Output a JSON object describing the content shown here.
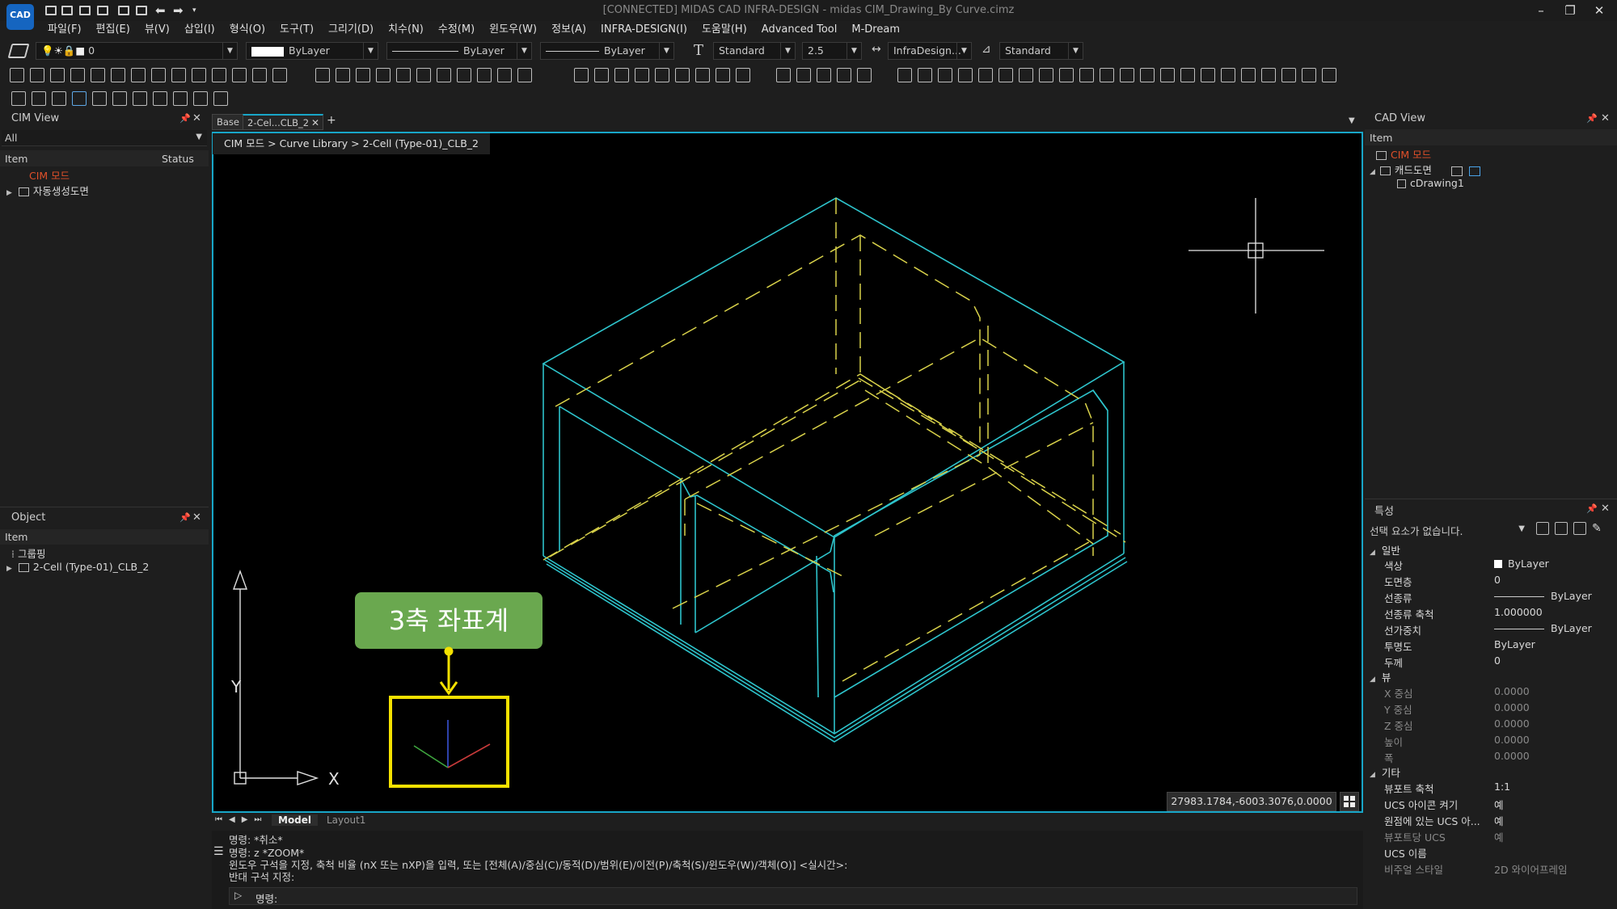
{
  "title": {
    "logo_text": "CAD",
    "window_title": "[CONNECTED] MIDAS CAD INFRA-DESIGN - midas CIM_Drawing_By Curve.cimz",
    "controls": [
      "–",
      "❐",
      "✕"
    ]
  },
  "menu": [
    "파일(F)",
    "편집(E)",
    "뷰(V)",
    "삽입(I)",
    "형식(O)",
    "도구(T)",
    "그리기(D)",
    "치수(N)",
    "수정(M)",
    "윈도우(W)",
    "정보(A)",
    "INFRA-DESIGN(I)",
    "도움말(H)",
    "Advanced Tool",
    "M-Dream"
  ],
  "properties_toolbar": {
    "layer": "0",
    "color": "ByLayer",
    "linetype": "ByLayer",
    "lineweight": "ByLayer",
    "text_style": "Standard",
    "text_height": "2.5",
    "dim_style": "InfraDesign...",
    "table_style": "Standard"
  },
  "cim_view": {
    "title": "CIM View",
    "filter": "All",
    "col_item": "Item",
    "col_status": "Status",
    "items": [
      "CIM 모드",
      "자동생성도면"
    ]
  },
  "object_panel": {
    "title": "Object",
    "col_item": "Item",
    "items": [
      "그룹핑",
      "2-Cell (Type-01)_CLB_2"
    ]
  },
  "tabs": [
    "Base",
    "2-Cel...CLB_2",
    "+"
  ],
  "breadcrumb": "CIM 모드 > Curve Library > 2-Cell (Type-01)_CLB_2",
  "viewport": {
    "axis_x": "X",
    "axis_y": "Y",
    "callout": "3축 좌표계",
    "coordinates": "27983.1784,-6003.3076,0.0000"
  },
  "layout_tabs": [
    "Model",
    "Layout1"
  ],
  "command_lines": [
    "명령: *취소*",
    "명령: z *ZOOM*",
    "윈도우 구석을 지정, 축척 비율 (nX 또는 nXP)을 입력, 또는 [전체(A)/중심(C)/동적(D)/범위(E)/이전(P)/축척(S)/윈도우(W)/객체(O)] <실시간>:",
    "반대 구석 지정:"
  ],
  "command_prompt": "명령:",
  "cad_view": {
    "title": "CAD View",
    "col_item": "Item",
    "items": [
      "CIM 모드",
      "캐드도면",
      "cDrawing1"
    ]
  },
  "properties": {
    "title": "특성",
    "selection": "선택 요소가 없습니다.",
    "sections": {
      "general": "일반",
      "view": "뷰",
      "misc": "기타"
    },
    "general_rows": [
      {
        "name": "색상",
        "value": "ByLayer"
      },
      {
        "name": "도면층",
        "value": "0"
      },
      {
        "name": "선종류",
        "value": "ByLayer"
      },
      {
        "name": "선종류 축척",
        "value": "1.000000"
      },
      {
        "name": "선가중치",
        "value": "ByLayer"
      },
      {
        "name": "투명도",
        "value": "ByLayer"
      },
      {
        "name": "두께",
        "value": "0"
      }
    ],
    "view_rows": [
      {
        "name": "X 중심",
        "value": "0.0000"
      },
      {
        "name": "Y 중심",
        "value": "0.0000"
      },
      {
        "name": "Z 중심",
        "value": "0.0000"
      },
      {
        "name": "높이",
        "value": "0.0000"
      },
      {
        "name": "폭",
        "value": "0.0000"
      }
    ],
    "misc_rows": [
      {
        "name": "뷰포트 축척",
        "value": "1:1"
      },
      {
        "name": "UCS 아이콘 켜기",
        "value": "예"
      },
      {
        "name": "원점에 있는 UCS 아...",
        "value": "예"
      },
      {
        "name": "뷰포트당 UCS",
        "value": "예"
      },
      {
        "name": "UCS 이름",
        "value": ""
      },
      {
        "name": "비주얼 스타일",
        "value": "2D 와이어프레임"
      }
    ]
  },
  "colors": {
    "accent": "#18a6c8",
    "drawing_cyan": "#2ec4cc",
    "drawing_yellow": "#d9d24a",
    "callout_green": "#6aa84f",
    "highlight_yellow": "#f4e100"
  }
}
